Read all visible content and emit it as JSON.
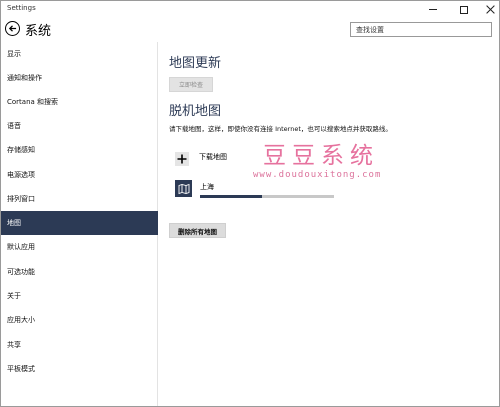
{
  "window": {
    "title": "Settings"
  },
  "header": {
    "page_title": "系统",
    "search_placeholder": "查找设置"
  },
  "sidebar": {
    "items": [
      {
        "label": "显示"
      },
      {
        "label": "通知和操作"
      },
      {
        "label": "Cortana 和搜索"
      },
      {
        "label": "语音"
      },
      {
        "label": "存储感知"
      },
      {
        "label": "电源选项"
      },
      {
        "label": "排列窗口"
      },
      {
        "label": "地图",
        "selected": true
      },
      {
        "label": "默认应用"
      },
      {
        "label": "可选功能"
      },
      {
        "label": "关于"
      },
      {
        "label": "应用大小"
      },
      {
        "label": "共享"
      },
      {
        "label": "平板模式"
      }
    ]
  },
  "main": {
    "map_update": {
      "title": "地图更新",
      "check_button": "立即检查"
    },
    "offline_maps": {
      "title": "脱机地图",
      "description": "请下载地图，这样，即使你没有连接 Internet，也可以搜索地点并获取路线。",
      "add_label": "下载地图",
      "downloads": [
        {
          "name": "上海",
          "progress": 0.46
        }
      ],
      "delete_all_button": "删除所有地图"
    }
  },
  "watermark": {
    "text": "豆豆系统",
    "url": "www.doudouxitong.com"
  },
  "colors": {
    "accent": "#2c3a55",
    "watermark": "#e25a8e"
  }
}
